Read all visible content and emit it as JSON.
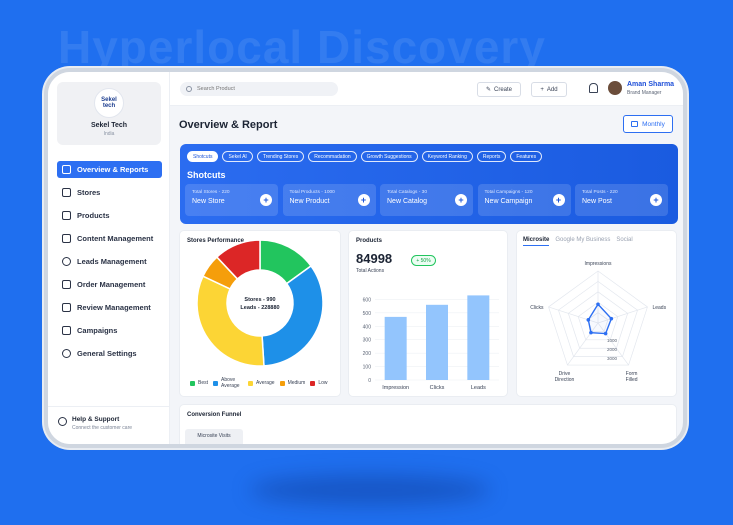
{
  "hero_title": "Hyperlocal Discovery",
  "brand": {
    "logo_text": "Sekel\ntech",
    "name": "Sekel Tech",
    "location": "India"
  },
  "sidebar": {
    "items": [
      {
        "label": "Overview & Reports",
        "icon": "grid-icon",
        "active": true
      },
      {
        "label": "Stores",
        "icon": "store-icon"
      },
      {
        "label": "Products",
        "icon": "box-icon"
      },
      {
        "label": "Content Management",
        "icon": "document-icon"
      },
      {
        "label": "Leads Management",
        "icon": "users-icon"
      },
      {
        "label": "Order Management",
        "icon": "bag-icon"
      },
      {
        "label": "Review Management",
        "icon": "chat-icon"
      },
      {
        "label": "Campaigns",
        "icon": "megaphone-icon"
      },
      {
        "label": "General Settings",
        "icon": "gear-icon"
      }
    ],
    "help": {
      "title": "Help & Support",
      "subtitle": "Connect the customer care"
    }
  },
  "topbar": {
    "search_placeholder": "Search Product",
    "create_label": "Create",
    "add_label": "Add",
    "user": {
      "name": "Aman Sharma",
      "role": "Brand Manager"
    }
  },
  "main": {
    "title": "Overview & Report",
    "period_label": "Monthly",
    "shortcuts": {
      "chips": [
        "Shotcuts",
        "Sekel AI",
        "Trending Stores",
        "Recommadation",
        "Growth Suggestions",
        "Keyword Ranking",
        "Reports",
        "Features"
      ],
      "title": "Shotcuts",
      "cards": [
        {
          "label": "Total Stores - 220",
          "action": "New Store"
        },
        {
          "label": "Total Products - 1000",
          "action": "New Product"
        },
        {
          "label": "Total Catalogs - 30",
          "action": "New Catalog"
        },
        {
          "label": "Total Campaigns - 120",
          "action": "New Campaign"
        },
        {
          "label": "Total Posts - 220",
          "action": "New Post"
        }
      ]
    },
    "stores_performance": {
      "title": "Stores Performance",
      "center_line1": "Stores - 990",
      "center_line2": "Leads - 228880"
    },
    "products": {
      "title": "Products",
      "value": "84998",
      "value_label": "Total Actions",
      "change": "+ 50%"
    },
    "tabs": [
      "Microsite",
      "Google My Business",
      "Social"
    ],
    "conversion": {
      "title": "Conversion Funnel",
      "first_step": "Microsite Visits"
    }
  },
  "chart_data": [
    {
      "type": "pie",
      "title": "Stores Performance",
      "labels": [
        "Best",
        "Above Average",
        "Average",
        "Medium",
        "Low"
      ],
      "values": [
        15,
        34,
        33,
        6,
        12
      ],
      "colors": [
        "#22c55e",
        "#1e90e8",
        "#fcd535",
        "#f59e0b",
        "#dc2626"
      ]
    },
    {
      "type": "bar",
      "title": "Products",
      "categories": [
        "Impression",
        "Clicks",
        "Leads"
      ],
      "values": [
        470,
        560,
        630
      ],
      "ylim": [
        0,
        700
      ],
      "yticks": [
        0,
        100,
        200,
        300,
        400,
        500,
        600
      ],
      "color": "#93c5fd"
    },
    {
      "type": "radar",
      "axes": [
        "Impressions",
        "Leads",
        "Form Filled",
        "Drive Direction",
        "Clicks"
      ],
      "values": [
        1800,
        1350,
        1250,
        1150,
        980
      ],
      "rings": [
        1000,
        2000,
        3000,
        4000,
        5000
      ],
      "ring_labels": [
        "1000",
        "2000",
        "3000"
      ],
      "color": "#2d6ff2"
    }
  ]
}
